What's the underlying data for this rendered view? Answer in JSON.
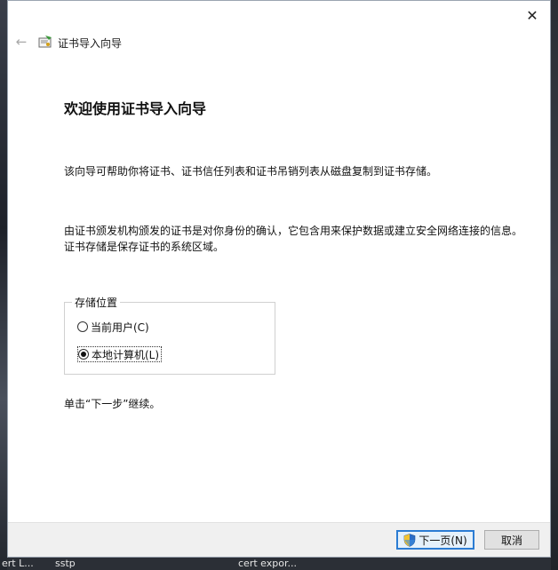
{
  "window": {
    "title": "证书导入向导",
    "close_glyph": "✕",
    "back_glyph": "←"
  },
  "main": {
    "heading": "欢迎使用证书导入向导",
    "intro": "该向导可帮助你将证书、证书信任列表和证书吊销列表从磁盘复制到证书存储。",
    "description": "由证书颁发机构颁发的证书是对你身份的确认，它包含用来保护数据或建立安全网络连接的信息。证书存储是保存证书的系统区域。",
    "store_location": {
      "legend": "存储位置",
      "options": [
        {
          "label": "当前用户(C)",
          "checked": false
        },
        {
          "label": "本地计算机(L)",
          "checked": true
        }
      ]
    },
    "continue_hint": "单击“下一步”继续。"
  },
  "footer": {
    "next_label": "下一页(N)",
    "cancel_label": "取消"
  },
  "taskbar": {
    "items": [
      "ert L...",
      "sstp",
      "cert expor..."
    ]
  },
  "colors": {
    "accent": "#2b7cd3",
    "footer_bg": "#f0f0f0"
  }
}
